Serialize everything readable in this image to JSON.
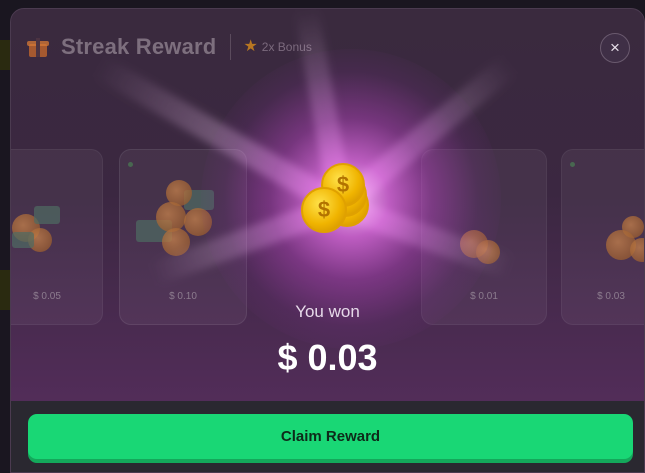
{
  "header": {
    "title": "Streak Reward",
    "bonus_label": "2x Bonus",
    "close_symbol": "×",
    "gift_icon": "gift-icon",
    "star_icon": "star-icon"
  },
  "cards": [
    {
      "amount": "$ 0.05"
    },
    {
      "amount": "$ 0.10"
    },
    {
      "amount": "$ 0.01"
    },
    {
      "amount": "$ 0.03"
    }
  ],
  "reward": {
    "label": "You won",
    "amount": "$ 0.03"
  },
  "footer": {
    "claim_label": "Claim Reward"
  },
  "colors": {
    "accent": "#19d775",
    "glow": "#e86eeb",
    "coin": "#f0b400"
  }
}
